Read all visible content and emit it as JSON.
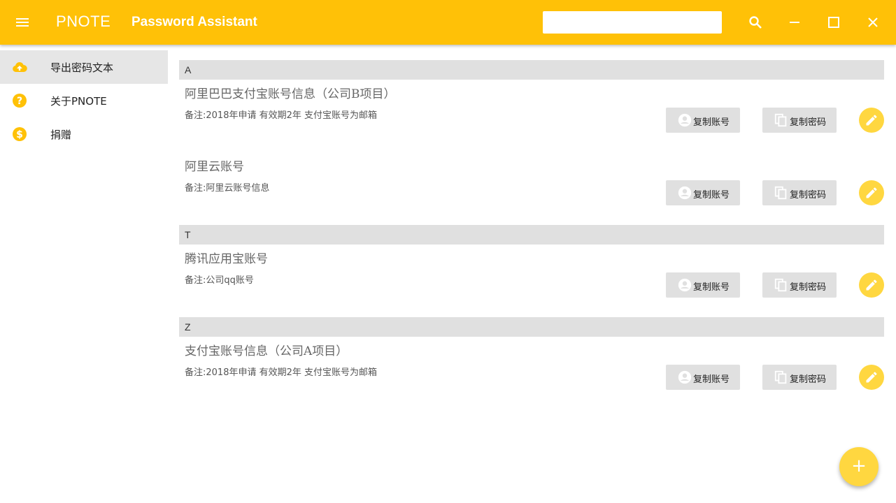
{
  "header": {
    "app_name": "PNOTE",
    "subtitle": "Password Assistant",
    "search": {
      "value": "",
      "placeholder": ""
    },
    "icons": [
      "menu-icon",
      "search-icon",
      "minimize-icon",
      "maximize-icon",
      "close-icon"
    ]
  },
  "sidebar": {
    "items": [
      {
        "label": "导出密码文本",
        "icon": "cloud-upload-icon",
        "active": true
      },
      {
        "label": "关于PNOTE",
        "icon": "help-icon",
        "active": false
      },
      {
        "label": "捐赠",
        "icon": "dollar-icon",
        "active": false
      }
    ]
  },
  "groups": [
    {
      "letter": "A",
      "entries": [
        {
          "title": "阿里巴巴支付宝账号信息（公司B项目）",
          "note": "备注:2018年申请 有效期2年 支付宝账号为邮箱"
        },
        {
          "title": "阿里云账号",
          "note": "备注:阿里云账号信息"
        }
      ]
    },
    {
      "letter": "T",
      "entries": [
        {
          "title": "腾讯应用宝账号",
          "note": "备注:公司qq账号"
        }
      ]
    },
    {
      "letter": "Z",
      "entries": [
        {
          "title": "支付宝账号信息（公司A项目）",
          "note": "备注:2018年申请 有效期2年 支付宝账号为邮箱"
        }
      ]
    }
  ],
  "buttons": {
    "copy_account": "复制账号",
    "copy_password": "复制密码",
    "add": "+"
  },
  "colors": {
    "accent": "#FFC107",
    "fab": "#FFD740",
    "header_bg": "#e0e0e0"
  }
}
